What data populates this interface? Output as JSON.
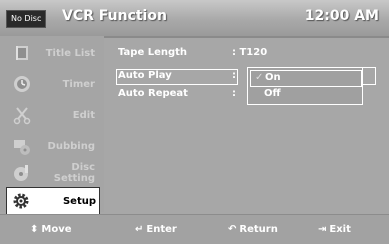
{
  "header": {
    "disc_badge": "No Disc",
    "title": "VCR Function",
    "time": "12:00 AM"
  },
  "sidebar": {
    "items": [
      {
        "label": "Title List",
        "icon": "title-list-icon"
      },
      {
        "label": "Timer",
        "icon": "timer-icon"
      },
      {
        "label": "Edit",
        "icon": "edit-scissors-icon"
      },
      {
        "label": "Dubbing",
        "icon": "dubbing-icon"
      },
      {
        "label": "Disc Setting",
        "label_line1": "Disc",
        "label_line2": "Setting",
        "icon": "disc-setting-icon"
      },
      {
        "label": "Setup",
        "icon": "setup-gear-icon",
        "active": true
      }
    ]
  },
  "settings": {
    "tape_length": {
      "label": "Tape Length",
      "value": ": T120"
    },
    "auto_play": {
      "label": "Auto Play",
      "colon": ":"
    },
    "auto_repeat": {
      "label": "Auto Repeat",
      "colon": ":"
    }
  },
  "dropdown": {
    "options": [
      {
        "label": "On",
        "selected": true,
        "check": "✓"
      },
      {
        "label": "Off",
        "selected": false
      }
    ]
  },
  "footer": {
    "move": {
      "glyph": "⬍",
      "label": "Move"
    },
    "enter": {
      "glyph": "↵",
      "label": "Enter"
    },
    "return": {
      "glyph": "↶",
      "label": "Return"
    },
    "exit": {
      "glyph": "⇥",
      "label": "Exit"
    }
  },
  "colors": {
    "background": "#a7a7a7",
    "text": "#ffffff",
    "active_bg": "#ffffff"
  }
}
